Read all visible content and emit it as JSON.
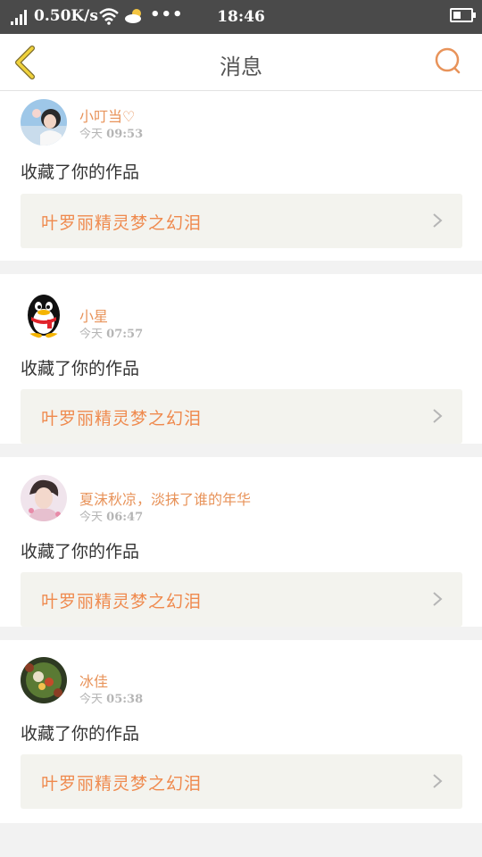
{
  "status_bar": {
    "speed": "0.50K/s",
    "dots": "•••",
    "time": "18:46"
  },
  "nav": {
    "title": "消息",
    "back_icon": "chevron-left-icon",
    "search_icon": "search-icon",
    "accent_color": "#e8935a"
  },
  "messages": [
    {
      "name": "小叮当♡",
      "time_day": "今天",
      "time_clock": "09:53",
      "action": "收藏了你的作品",
      "work_title": "叶罗丽精灵梦之幻泪",
      "avatar": "girl-photo"
    },
    {
      "name": "小星",
      "time_day": "今天",
      "time_clock": "07:57",
      "action": "收藏了你的作品",
      "work_title": "叶罗丽精灵梦之幻泪",
      "avatar": "qq-penguin"
    },
    {
      "name": "夏沫秋凉，淡抹了谁的年华",
      "time_day": "今天",
      "time_clock": "06:47",
      "action": "收藏了你的作品",
      "work_title": "叶罗丽精灵梦之幻泪",
      "avatar": "boy-photo"
    },
    {
      "name": "冰佳",
      "time_day": "今天",
      "time_clock": "05:38",
      "action": "收藏了你的作品",
      "work_title": "叶罗丽精灵梦之幻泪",
      "avatar": "food-photo"
    }
  ]
}
